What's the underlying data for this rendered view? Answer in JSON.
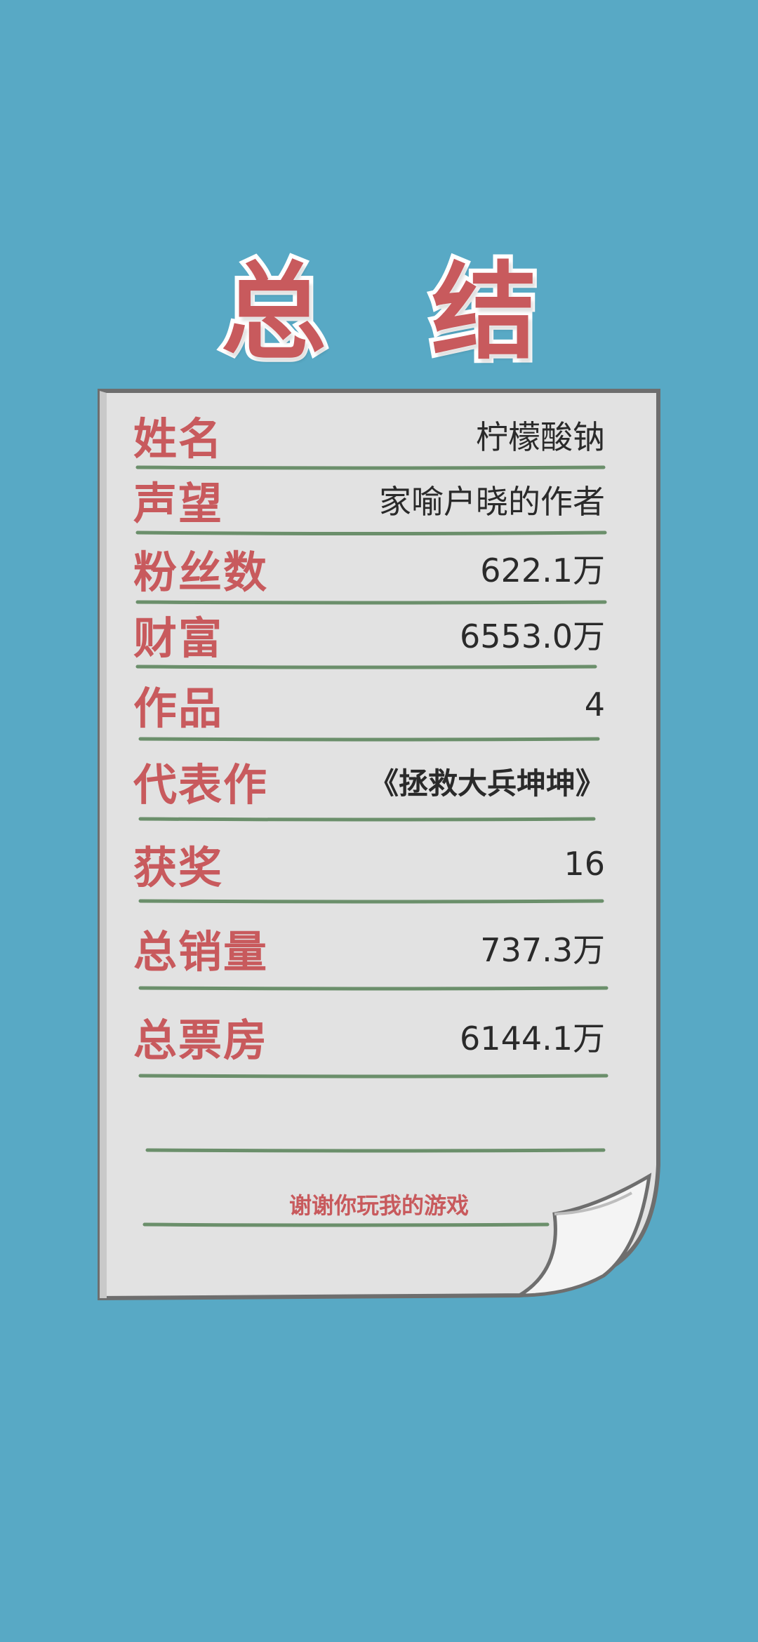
{
  "title": {
    "char1": "总",
    "char2": "结"
  },
  "rows": [
    {
      "label": "姓名",
      "value": "柠檬酸钠"
    },
    {
      "label": "声望",
      "value": "家喻户晓的作者"
    },
    {
      "label": "粉丝数",
      "value": "622.1万"
    },
    {
      "label": "财富",
      "value": "6553.0万"
    },
    {
      "label": "作品",
      "value": "4"
    },
    {
      "label": "代表作",
      "value": "《拯救大兵坤坤》"
    },
    {
      "label": "获奖",
      "value": "16"
    },
    {
      "label": "总销量",
      "value": "737.3万"
    },
    {
      "label": "总票房",
      "value": "6144.1万"
    }
  ],
  "footer": {
    "thanks": "谢谢你玩我的游戏"
  },
  "colors": {
    "background": "#58a9c5",
    "label": "#c85a5d",
    "paper": "#e2e2e2",
    "rule": "#6b8f6b",
    "border": "#6e6e6e"
  }
}
